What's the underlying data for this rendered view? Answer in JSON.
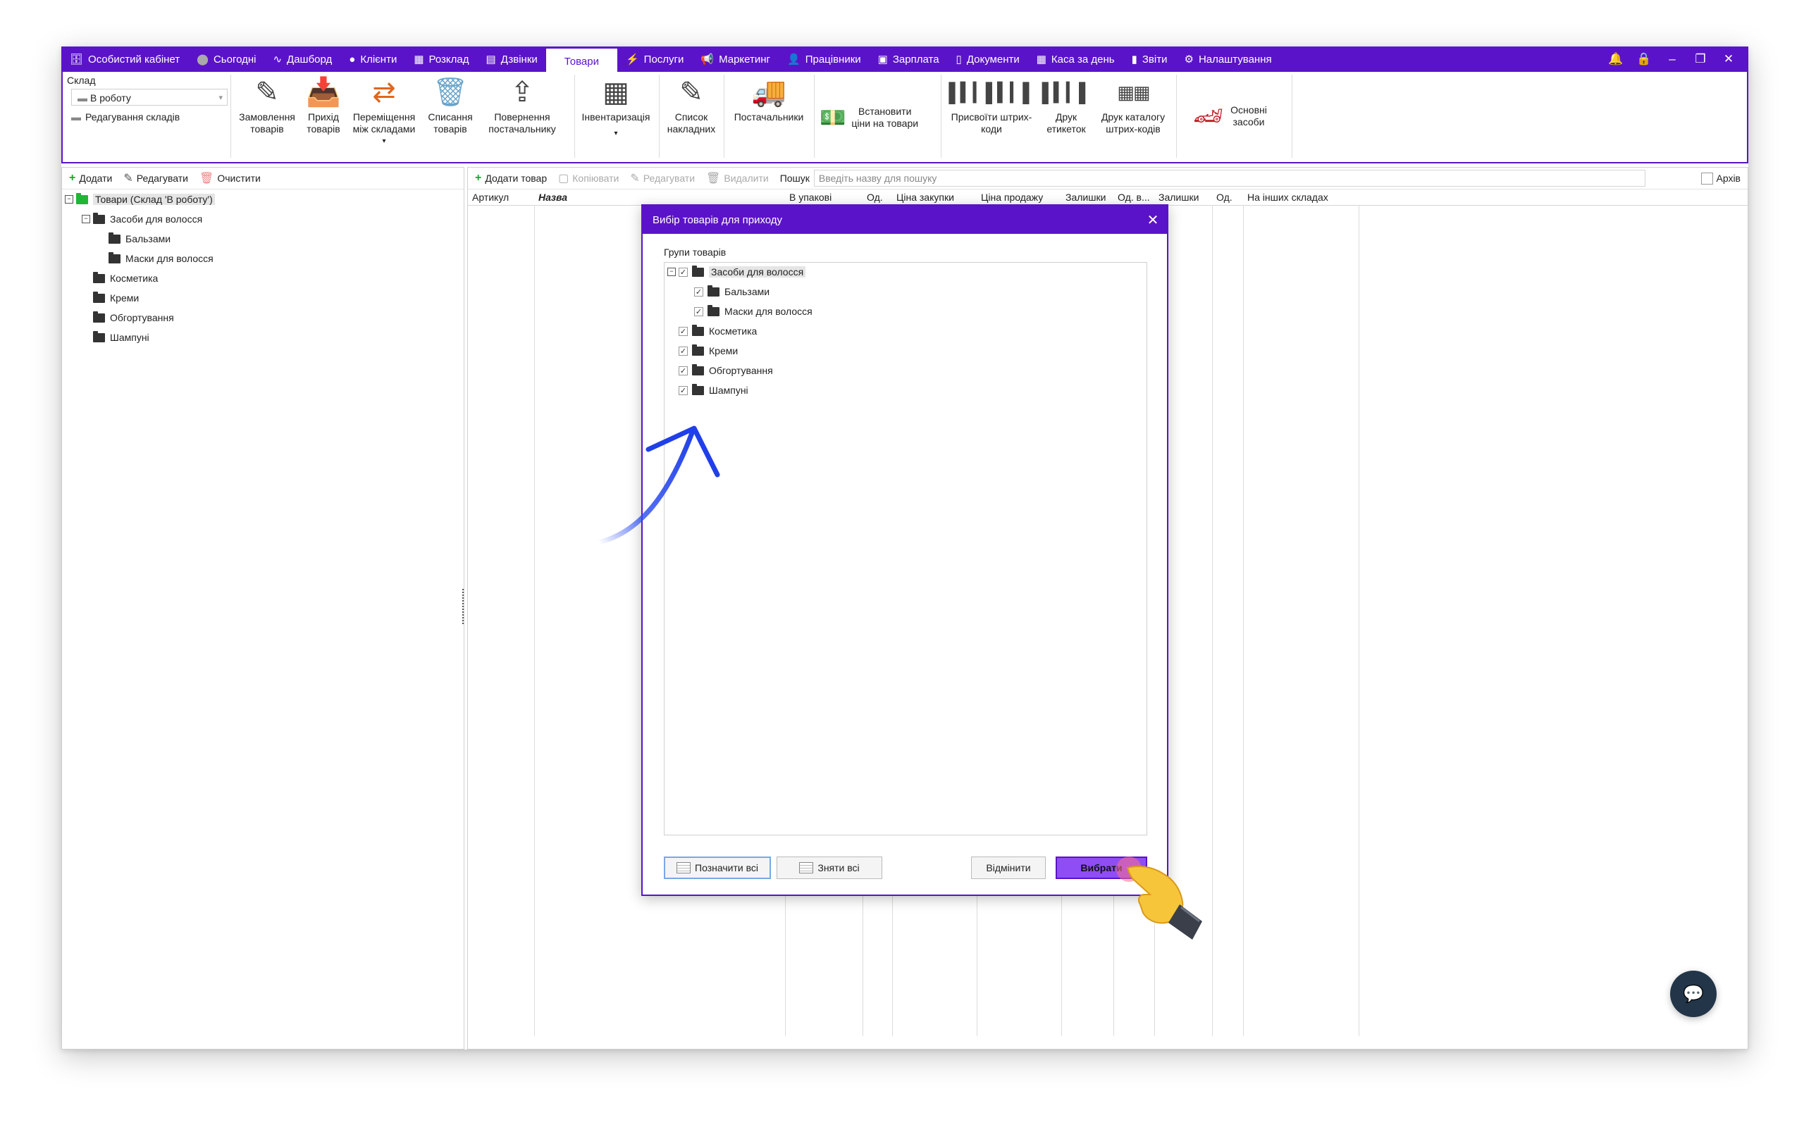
{
  "topnav": {
    "items": [
      {
        "icon": "briefcase-icon",
        "glyph": "🗄",
        "label": "Особистий кабінет"
      },
      {
        "icon": "today-icon",
        "glyph": "⬤",
        "label": "Сьогодні"
      },
      {
        "icon": "pulse-icon",
        "glyph": "∿",
        "label": "Дашборд"
      },
      {
        "icon": "user-circle-icon",
        "glyph": "●",
        "label": "Клієнти"
      },
      {
        "icon": "calendar-icon",
        "glyph": "▦",
        "label": "Розклад"
      },
      {
        "icon": "phone-book-icon",
        "glyph": "▤",
        "label": "Дзвінки"
      },
      {
        "icon": "",
        "glyph": "",
        "label": "Товари",
        "active": true
      },
      {
        "icon": "lightning-icon",
        "glyph": "⚡",
        "label": "Послуги"
      },
      {
        "icon": "megaphone-icon",
        "glyph": "📢",
        "label": "Маркетинг"
      },
      {
        "icon": "person-icon",
        "glyph": "👤",
        "label": "Працівники"
      },
      {
        "icon": "money-icon",
        "glyph": "▣",
        "label": "Зарплата"
      },
      {
        "icon": "document-icon",
        "glyph": "▯",
        "label": "Документи"
      },
      {
        "icon": "calculator-icon",
        "glyph": "▦",
        "label": "Каса за день"
      },
      {
        "icon": "bar-chart-icon",
        "glyph": "▮",
        "label": "Звіти"
      },
      {
        "icon": "gear-icon",
        "glyph": "⚙",
        "label": "Налаштування"
      }
    ],
    "colors": {
      "accent": "#5b13c9",
      "primary_button": "#8f4df5"
    }
  },
  "ribbon": {
    "sklad_label": "Склад",
    "sklad_value": "В роботу",
    "edit_warehouses": "Редагування складів",
    "buttons": [
      {
        "icon": "pencil-icon",
        "label1": "Замовлення",
        "label2": "товарів"
      },
      {
        "icon": "inbox-download-icon",
        "label1": "Прихід",
        "label2": "товарів"
      },
      {
        "icon": "transfer-arrows-icon",
        "label1": "Переміщення",
        "label2": "між складами"
      },
      {
        "icon": "trash-bin-icon",
        "label1": "Списання",
        "label2": "товарів"
      },
      {
        "icon": "upload-icon",
        "label1": "Повернення",
        "label2": "постачальнику"
      },
      {
        "icon": "calculator-icon",
        "label1": "Інвентаризація",
        "label2": ""
      },
      {
        "icon": "pencil-list-icon",
        "label1": "Список",
        "label2": "накладних"
      },
      {
        "icon": "truck-icon",
        "label1": "Постачальники",
        "label2": ""
      },
      {
        "icon": "cash-icon",
        "label1": "Встановити",
        "label2": "ціни на товари"
      },
      {
        "icon": "barcode-icon",
        "label1": "Присвоїти штрих-",
        "label2": "коди"
      },
      {
        "icon": "barcode-print-icon",
        "label1": "Друк",
        "label2": "етикеток"
      },
      {
        "icon": "barcode-catalog-icon",
        "label1": "Друк каталогу",
        "label2": "штрих-кодів"
      },
      {
        "icon": "car-icon",
        "label1": "Основні",
        "label2": "засоби"
      }
    ]
  },
  "left_panel": {
    "toolbar": {
      "add": "Додати",
      "edit": "Редагувати",
      "clear": "Очистити"
    },
    "tree": {
      "root": "Товари (Склад 'В роботу')",
      "hair": "Засоби для волосся",
      "balms": "Бальзами",
      "masks": "Маски для волосся",
      "cosmetics": "Косметика",
      "creams": "Креми",
      "wraps": "Обгортування",
      "shampoos": "Шампуні"
    }
  },
  "right_panel": {
    "toolbar": {
      "add": "Додати товар",
      "copy": "Копіювати",
      "edit": "Редагувати",
      "delete": "Видалити",
      "search_label": "Пошук",
      "search_placeholder": "Введіть назву для пошуку",
      "archive": "Архів"
    },
    "columns": [
      "Артикул",
      "Назва",
      "В упакові",
      "Од.",
      "Ціна закупки",
      "Ціна продажу",
      "Залишки",
      "Од. в...",
      "Залишки",
      "Од.",
      "На інших складах"
    ]
  },
  "dialog": {
    "title": "Вибір товарів для приходу",
    "groups_label": "Групи товарів",
    "tree": {
      "hair": "Засоби для волосся",
      "balms": "Бальзами",
      "masks": "Маски для волосся",
      "cosmetics": "Косметика",
      "creams": "Креми",
      "wraps": "Обгортування",
      "shampoos": "Шампуні"
    },
    "buttons": {
      "select_all": "Позначити всі",
      "deselect_all": "Зняти всі",
      "cancel": "Відмінити",
      "choose": "Вибрати"
    }
  }
}
